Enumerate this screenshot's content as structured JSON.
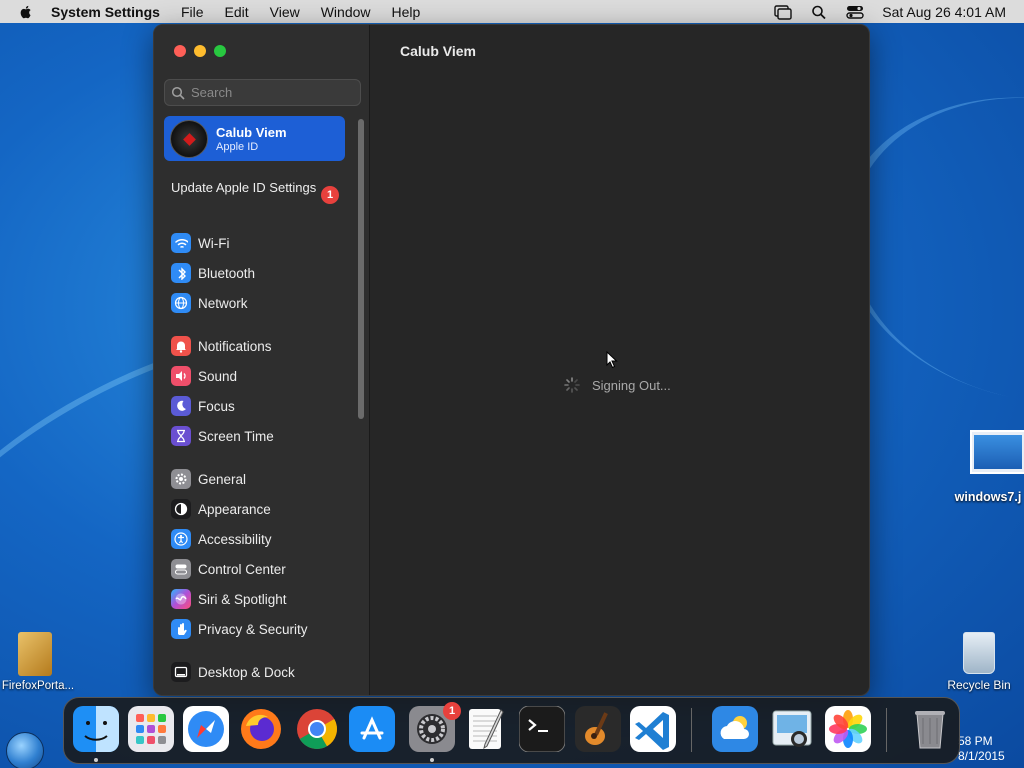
{
  "menubar": {
    "app_name": "System Settings",
    "items": [
      "File",
      "Edit",
      "View",
      "Window",
      "Help"
    ],
    "datetime": "Sat Aug 26  4:01 AM"
  },
  "window": {
    "main_title": "Calub Viem",
    "status_text": "Signing Out..."
  },
  "sidebar": {
    "search_placeholder": "Search",
    "profile": {
      "name": "Calub Viem",
      "subtitle": "Apple ID"
    },
    "update": {
      "label": "Update Apple ID Settings",
      "badge": "1"
    },
    "groups": [
      [
        {
          "label": "Wi-Fi",
          "icon": "wifi-icon",
          "color": "#2f8bf5"
        },
        {
          "label": "Bluetooth",
          "icon": "bluetooth-icon",
          "color": "#2f8bf5"
        },
        {
          "label": "Network",
          "icon": "globe-icon",
          "color": "#2f8bf5"
        }
      ],
      [
        {
          "label": "Notifications",
          "icon": "bell-icon",
          "color": "#f0524b"
        },
        {
          "label": "Sound",
          "icon": "speaker-icon",
          "color": "#ef4f6a"
        },
        {
          "label": "Focus",
          "icon": "moon-icon",
          "color": "#5b5bd6"
        },
        {
          "label": "Screen Time",
          "icon": "hourglass-icon",
          "color": "#6a4fd1"
        }
      ],
      [
        {
          "label": "General",
          "icon": "gear-icon",
          "color": "#8e8e93"
        },
        {
          "label": "Appearance",
          "icon": "appearance-icon",
          "color": "#1c1c1e"
        },
        {
          "label": "Accessibility",
          "icon": "accessibility-icon",
          "color": "#2f8bf5"
        },
        {
          "label": "Control Center",
          "icon": "control-center-icon",
          "color": "#8e8e93"
        },
        {
          "label": "Siri & Spotlight",
          "icon": "siri-icon",
          "color": "#b04fd6"
        },
        {
          "label": "Privacy & Security",
          "icon": "hand-icon",
          "color": "#2f8bf5"
        }
      ],
      [
        {
          "label": "Desktop & Dock",
          "icon": "dock-icon",
          "color": "#1c1c1e"
        }
      ]
    ]
  },
  "desktop": {
    "icons": [
      {
        "label": "windows7.j"
      },
      {
        "label": "FirefoxPorta..."
      },
      {
        "label": "Recycle Bin"
      }
    ],
    "taskbar_time": "58 PM",
    "taskbar_date": "8/1/2015"
  },
  "dock": {
    "apps": [
      {
        "name": "Finder",
        "icon": "finder-icon"
      },
      {
        "name": "Launchpad",
        "icon": "launchpad-icon"
      },
      {
        "name": "Safari",
        "icon": "safari-icon"
      },
      {
        "name": "Firefox",
        "icon": "firefox-icon"
      },
      {
        "name": "Chrome",
        "icon": "chrome-icon"
      },
      {
        "name": "App Store",
        "icon": "app-store-icon"
      },
      {
        "name": "System Settings",
        "icon": "system-settings-icon",
        "badge": "1"
      },
      {
        "name": "TextEdit",
        "icon": "textedit-icon"
      },
      {
        "name": "Terminal",
        "icon": "terminal-icon"
      },
      {
        "name": "GarageBand",
        "icon": "garageband-icon"
      },
      {
        "name": "Visual Studio Code",
        "icon": "vscode-icon"
      },
      {
        "name": "Weather",
        "icon": "weather-icon"
      },
      {
        "name": "Preview",
        "icon": "preview-icon"
      },
      {
        "name": "Photos",
        "icon": "photos-icon"
      },
      {
        "name": "Trash",
        "icon": "trash-icon"
      }
    ]
  }
}
